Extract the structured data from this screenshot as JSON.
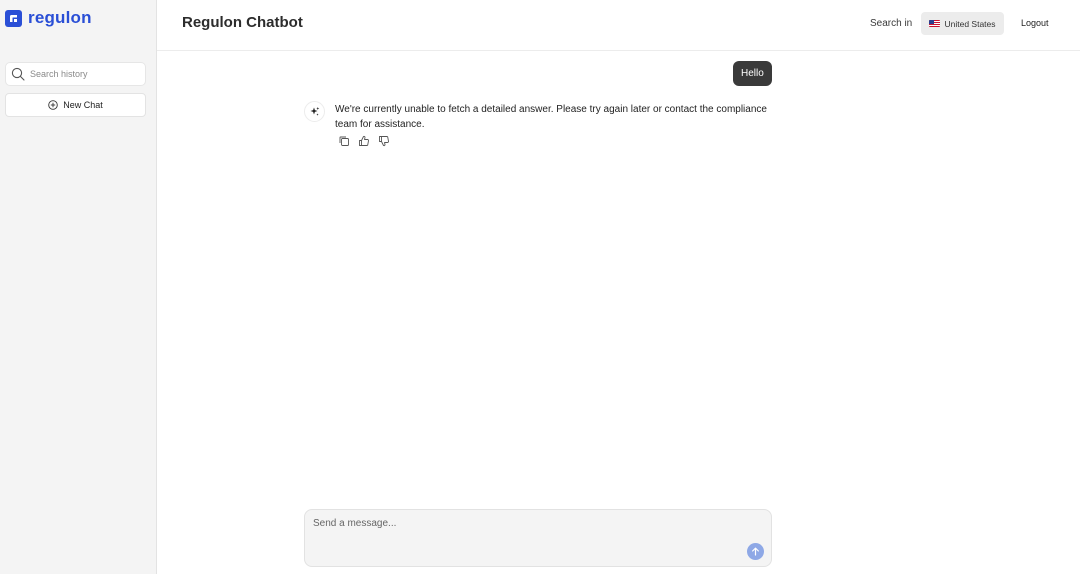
{
  "app": {
    "brand_name": "regulon",
    "brand_color": "#2a4fd6"
  },
  "sidebar": {
    "search": {
      "placeholder": "Search history",
      "value": ""
    },
    "new_chat_label": "New Chat"
  },
  "header": {
    "title": "Regulon Chatbot",
    "search_in_label": "Search in",
    "country": {
      "label": "United States",
      "flag_icon": "us-flag-icon"
    },
    "logout_label": "Logout"
  },
  "chat": {
    "messages": [
      {
        "role": "user",
        "text": "Hello"
      },
      {
        "role": "assistant",
        "text": "We're currently unable to fetch a detailed answer. Please try again later or contact the compliance team for assistance."
      }
    ],
    "actions": [
      "copy-icon",
      "thumbs-up-icon",
      "thumbs-down-icon"
    ]
  },
  "composer": {
    "placeholder": "Send a message...",
    "value": "",
    "send_icon": "arrow-up-icon",
    "send_color": "#8ea8e6"
  }
}
